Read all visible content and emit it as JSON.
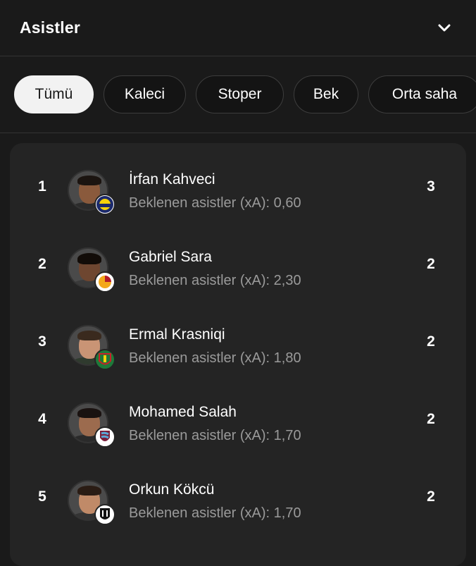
{
  "header": {
    "title": "Asistler"
  },
  "filters": [
    {
      "label": "Tümü",
      "active": true
    },
    {
      "label": "Kaleci",
      "active": false
    },
    {
      "label": "Stoper",
      "active": false
    },
    {
      "label": "Bek",
      "active": false
    },
    {
      "label": "Orta saha",
      "active": false
    }
  ],
  "players": [
    {
      "rank": "1",
      "name": "İrfan Kahveci",
      "xa": "Beklenen asistler (xA): 0,60",
      "assists": "3",
      "club_badge": "fenerbahce-badge"
    },
    {
      "rank": "2",
      "name": "Gabriel Sara",
      "xa": "Beklenen asistler (xA): 2,30",
      "assists": "2",
      "club_badge": "galatasaray-badge"
    },
    {
      "rank": "3",
      "name": "Ermal Krasniqi",
      "xa": "Beklenen asistler (xA): 1,80",
      "assists": "2",
      "club_badge": "amedspor-badge"
    },
    {
      "rank": "4",
      "name": "Mohamed Salah",
      "xa": "Beklenen asistler (xA): 1,70",
      "assists": "2",
      "club_badge": "trabzonspor-badge"
    },
    {
      "rank": "5",
      "name": "Orkun Kökcü",
      "xa": "Beklenen asistler (xA): 1,70",
      "assists": "2",
      "club_badge": "besiktas-badge"
    }
  ],
  "colors": {
    "background": "#1a1a1a",
    "card": "#242424",
    "chip_active": "#f2f2f2",
    "text_secondary": "#9a9a9a"
  }
}
